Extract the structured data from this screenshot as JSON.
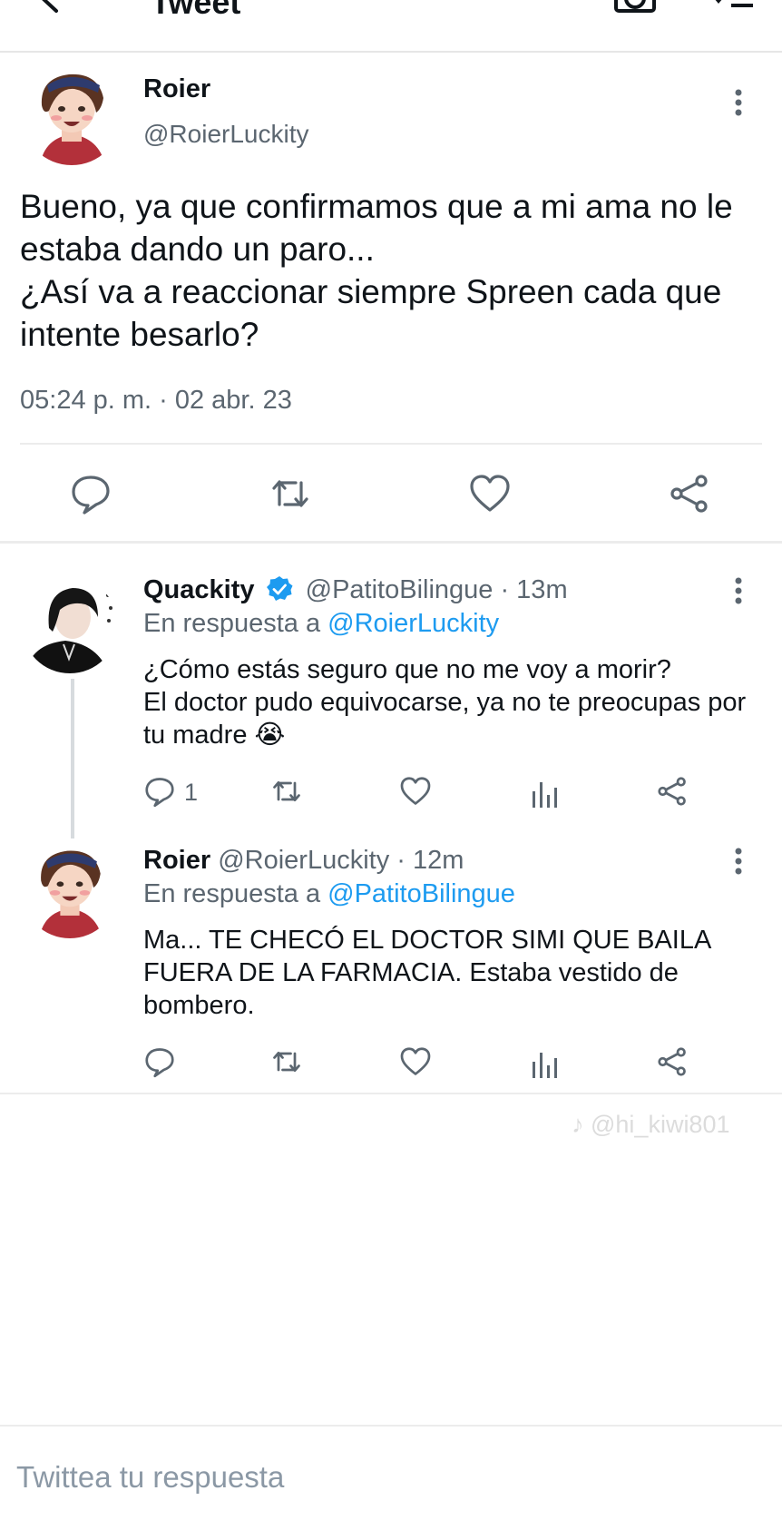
{
  "header": {
    "title": "Tweet",
    "icons": [
      "back-arrow-icon",
      "camera-icon",
      "list-icon"
    ]
  },
  "main_tweet": {
    "name": "Roier",
    "handle": "@RoierLuckity",
    "text": "Bueno, ya que confirmamos que a mi ama no le estaba dando un paro...\n¿Así va a reaccionar siempre Spreen cada que intente besarlo?",
    "timestamp": "05:24 p. m. · 02 abr. 23",
    "actions": [
      "reply-icon",
      "retweet-icon",
      "like-icon",
      "share-icon"
    ]
  },
  "replies": [
    {
      "name": "Quackity",
      "verified": true,
      "handle": "@PatitoBilingue",
      "time": "· 13m",
      "replying_to_label": "En respuesta a",
      "replying_to": "@RoierLuckity",
      "text": "¿Cómo estás seguro que no me voy a morir?\nEl doctor pudo equivocarse, ya no te preocupas por tu madre 😭",
      "reply_count": "1"
    },
    {
      "name": "Roier",
      "verified": false,
      "handle": "@RoierLuckity",
      "time": "· 12m",
      "replying_to_label": "En respuesta a",
      "replying_to": "@PatitoBilingue",
      "text": "Ma... TE CHECÓ EL DOCTOR SIMI QUE BAILA FUERA DE LA FARMACIA. Estaba vestido de bombero.",
      "reply_count": ""
    }
  ],
  "watermark": "♪ @hi_kiwi801",
  "compose": {
    "placeholder": "Twittea tu respuesta"
  },
  "colors": {
    "accent": "#1d9bf0",
    "text": "#0f1419",
    "secondary": "#5b6670",
    "divider": "#ececec"
  }
}
